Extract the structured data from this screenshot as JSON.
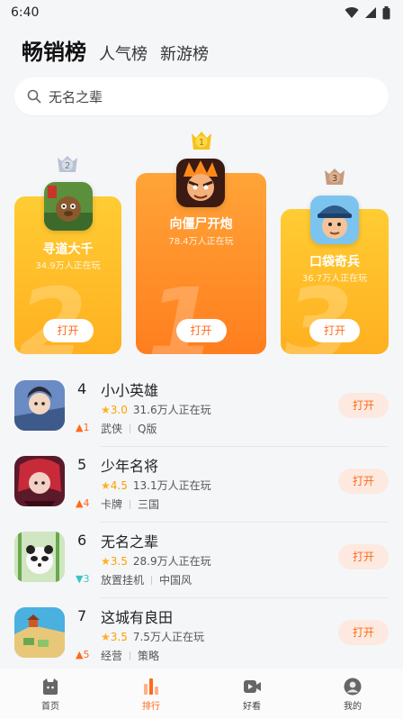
{
  "status": {
    "time": "6:40"
  },
  "tabs": {
    "active": "畅销榜",
    "popular": "人气榜",
    "new": "新游榜"
  },
  "search": {
    "text": "无名之辈"
  },
  "podium": [
    {
      "rank": "2",
      "name": "寻道大千",
      "players": "34.9万人正在玩",
      "open": "打开"
    },
    {
      "rank": "1",
      "name": "向僵尸开炮",
      "players": "78.4万人正在玩",
      "open": "打开"
    },
    {
      "rank": "3",
      "name": "口袋奇兵",
      "players": "36.7万人正在玩",
      "open": "打开"
    }
  ],
  "list": [
    {
      "rank": "4",
      "trend": "1",
      "trend_dir": "up",
      "name": "小小英雄",
      "score": "3.0",
      "players": "31.6万人正在玩",
      "tag1": "武侠",
      "tag2": "Q版",
      "btn": "打开"
    },
    {
      "rank": "5",
      "trend": "4",
      "trend_dir": "up",
      "name": "少年名将",
      "score": "4.5",
      "players": "13.1万人正在玩",
      "tag1": "卡牌",
      "tag2": "三国",
      "btn": "打开"
    },
    {
      "rank": "6",
      "trend": "3",
      "trend_dir": "down",
      "name": "无名之辈",
      "score": "3.5",
      "players": "28.9万人正在玩",
      "tag1": "放置挂机",
      "tag2": "中国风",
      "btn": "打开"
    },
    {
      "rank": "7",
      "trend": "5",
      "trend_dir": "up",
      "name": "这城有良田",
      "score": "3.5",
      "players": "7.5万人正在玩",
      "tag1": "经营",
      "tag2": "策略",
      "btn": "打开"
    }
  ],
  "nav": {
    "home": "首页",
    "rank": "排行",
    "watch": "好看",
    "mine": "我的"
  },
  "colors": {
    "accent": "#ff6a1a",
    "star": "#ffb020",
    "up": "#ff6a1a",
    "down": "#3bc4c4"
  }
}
